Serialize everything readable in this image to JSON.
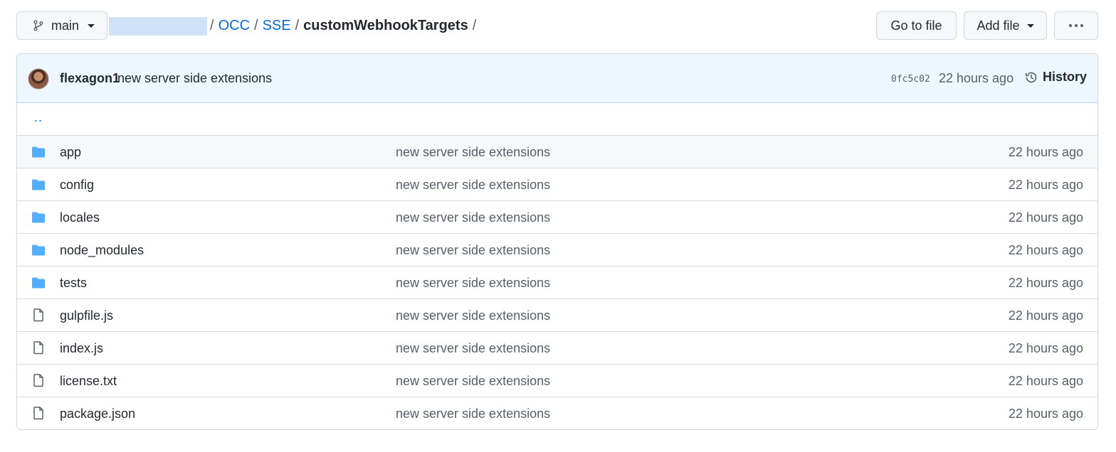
{
  "branch": {
    "label": "main"
  },
  "breadcrumb": {
    "items": [
      "OCC",
      "SSE"
    ],
    "current": "customWebhookTargets",
    "separator": "/"
  },
  "toolbar": {
    "go_to_file": "Go to file",
    "add_file": "Add file"
  },
  "commit": {
    "author": "flexagon1",
    "message": "new server side extensions",
    "sha": "0fc5c02",
    "time": "22 hours ago",
    "history_label": "History"
  },
  "parent_dir": "..",
  "files": [
    {
      "type": "folder",
      "name": "app",
      "message": "new server side extensions",
      "age": "22 hours ago"
    },
    {
      "type": "folder",
      "name": "config",
      "message": "new server side extensions",
      "age": "22 hours ago"
    },
    {
      "type": "folder",
      "name": "locales",
      "message": "new server side extensions",
      "age": "22 hours ago"
    },
    {
      "type": "folder",
      "name": "node_modules",
      "message": "new server side extensions",
      "age": "22 hours ago"
    },
    {
      "type": "folder",
      "name": "tests",
      "message": "new server side extensions",
      "age": "22 hours ago"
    },
    {
      "type": "file",
      "name": "gulpfile.js",
      "message": "new server side extensions",
      "age": "22 hours ago"
    },
    {
      "type": "file",
      "name": "index.js",
      "message": "new server side extensions",
      "age": "22 hours ago"
    },
    {
      "type": "file",
      "name": "license.txt",
      "message": "new server side extensions",
      "age": "22 hours ago"
    },
    {
      "type": "file",
      "name": "package.json",
      "message": "new server side extensions",
      "age": "22 hours ago"
    }
  ],
  "colors": {
    "link": "#0969da",
    "folder": "#54aeff",
    "commit_bg": "#eef6ff"
  }
}
